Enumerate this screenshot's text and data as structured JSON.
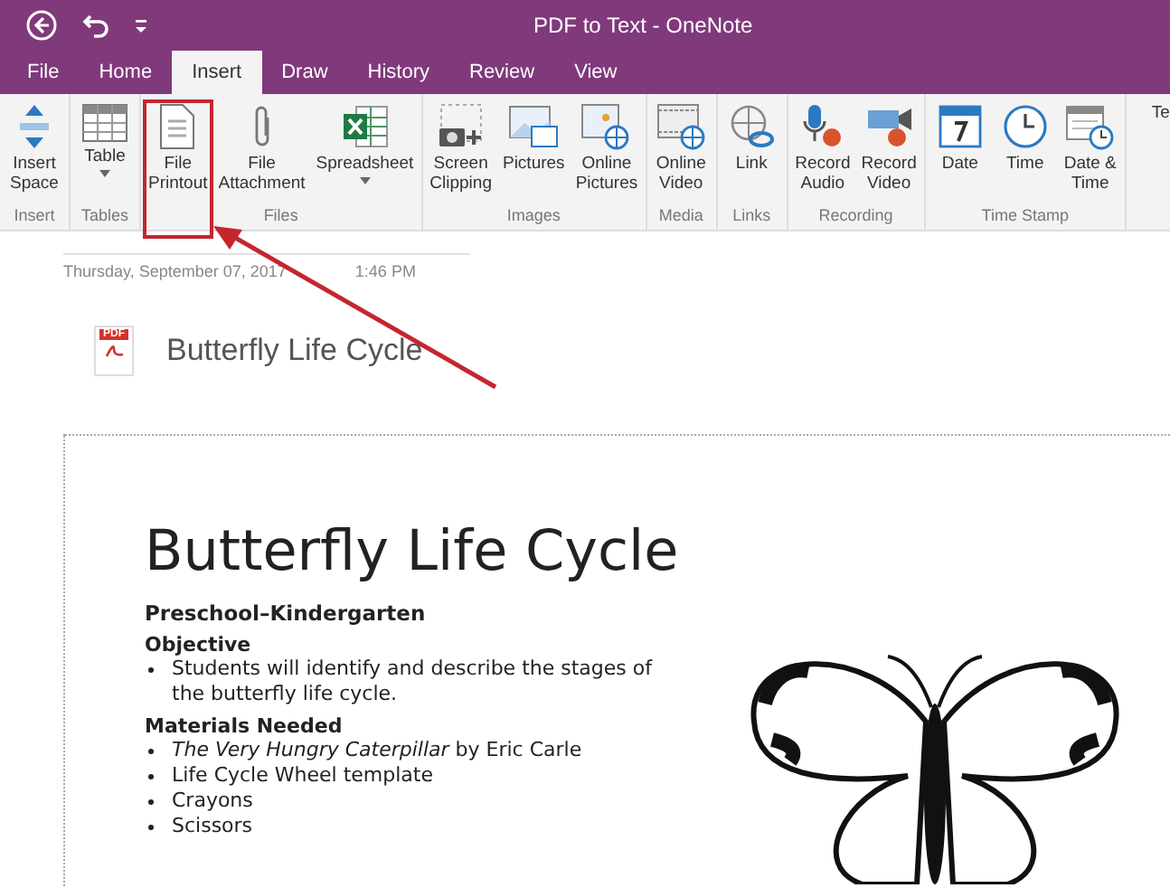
{
  "window": {
    "title": "PDF to Text  -  OneNote"
  },
  "tabs": [
    {
      "label": "File",
      "selected": false
    },
    {
      "label": "Home",
      "selected": false
    },
    {
      "label": "Insert",
      "selected": true
    },
    {
      "label": "Draw",
      "selected": false
    },
    {
      "label": "History",
      "selected": false
    },
    {
      "label": "Review",
      "selected": false
    },
    {
      "label": "View",
      "selected": false
    }
  ],
  "ribbon": {
    "groups": [
      {
        "name": "Insert",
        "buttons": [
          {
            "label": "Insert Space",
            "kind": "space",
            "dropdown": false,
            "highlighted": false
          }
        ]
      },
      {
        "name": "Tables",
        "buttons": [
          {
            "label": "Table",
            "kind": "table",
            "dropdown": true,
            "highlighted": false
          }
        ]
      },
      {
        "name": "Files",
        "buttons": [
          {
            "label": "File Printout",
            "kind": "printout",
            "dropdown": false,
            "highlighted": true
          },
          {
            "label": "File Attachment",
            "kind": "clip",
            "dropdown": false,
            "highlighted": false
          },
          {
            "label": "Spreadsheet",
            "kind": "sheet",
            "dropdown": true,
            "highlighted": false
          }
        ]
      },
      {
        "name": "Images",
        "buttons": [
          {
            "label": "Screen Clipping",
            "kind": "camera",
            "dropdown": false,
            "highlighted": false
          },
          {
            "label": "Pictures",
            "kind": "picture",
            "dropdown": false,
            "highlighted": false
          },
          {
            "label": "Online Pictures",
            "kind": "webpicture",
            "dropdown": false,
            "highlighted": false
          }
        ]
      },
      {
        "name": "Media",
        "buttons": [
          {
            "label": "Online Video",
            "kind": "film",
            "dropdown": false,
            "highlighted": false
          }
        ]
      },
      {
        "name": "Links",
        "buttons": [
          {
            "label": "Link",
            "kind": "link",
            "dropdown": false,
            "highlighted": false
          }
        ]
      },
      {
        "name": "Recording",
        "buttons": [
          {
            "label": "Record Audio",
            "kind": "mic",
            "dropdown": false,
            "highlighted": false
          },
          {
            "label": "Record Video",
            "kind": "videocam",
            "dropdown": false,
            "highlighted": false
          }
        ]
      },
      {
        "name": "Time Stamp",
        "buttons": [
          {
            "label": "Date",
            "kind": "calendar",
            "dropdown": false,
            "highlighted": false
          },
          {
            "label": "Time",
            "kind": "clock",
            "dropdown": false,
            "highlighted": false
          },
          {
            "label": "Date & Time",
            "kind": "calclock",
            "dropdown": false,
            "highlighted": false
          }
        ]
      },
      {
        "buttons": [
          {
            "label": "Te",
            "dropdown": false,
            "highlighted": false
          }
        ]
      }
    ]
  },
  "page": {
    "date": "Thursday, September 07, 2017",
    "time": "1:46 PM",
    "attachment": {
      "badge": "PDF",
      "name": "Butterfly Life Cycle"
    }
  },
  "printout": {
    "heading": "Butterfly Life Cycle",
    "subtitle": "Preschool–Kindergarten",
    "sections": [
      {
        "title": "Objective",
        "items": [
          "Students will identify and describe the stages of the butterfly life cycle."
        ]
      },
      {
        "title": "Materials Needed",
        "items": [
          "*The Very Hungry Caterpillar* by Eric Carle",
          "Life Cycle Wheel template",
          "Crayons",
          "Scissors"
        ]
      }
    ]
  }
}
